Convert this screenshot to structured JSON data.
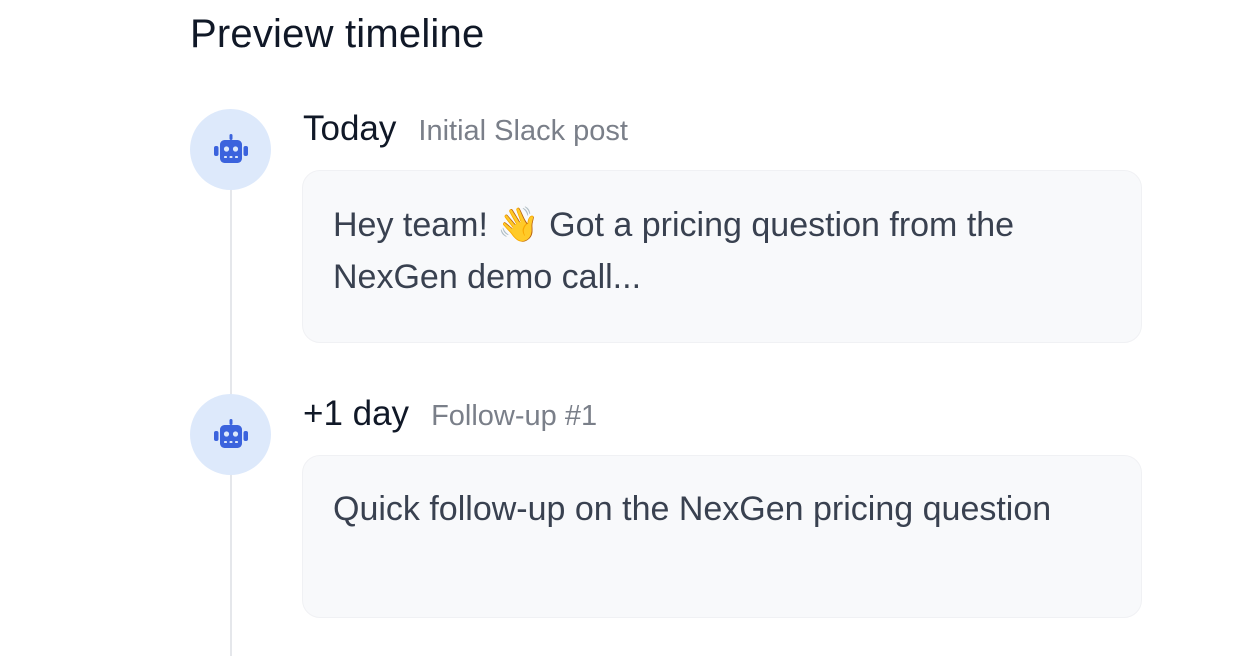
{
  "page": {
    "title": "Preview timeline"
  },
  "timeline": {
    "entries": [
      {
        "when": "Today",
        "label": "Initial Slack post",
        "avatar_icon": "robot-icon",
        "message": "Hey team! 👋 Got a pricing question from the NexGen demo call..."
      },
      {
        "when": "+1 day",
        "label": "Follow-up #1",
        "avatar_icon": "robot-icon",
        "message": "Quick follow-up on the NexGen pricing question"
      }
    ]
  },
  "colors": {
    "accent": "#3b63dd",
    "avatar_bg": "#dde9fb",
    "card_bg": "#f8f9fb",
    "line": "#e5e7eb"
  }
}
